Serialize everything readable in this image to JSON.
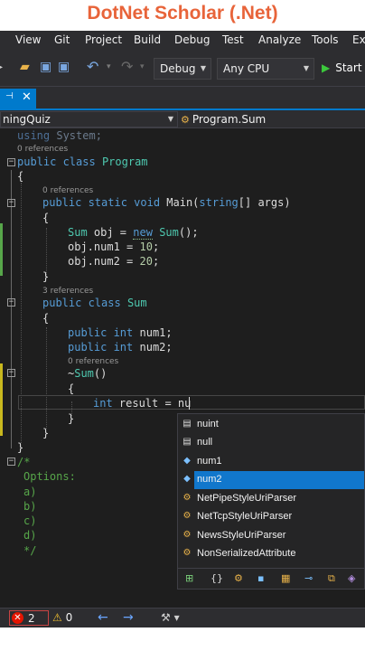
{
  "banner": {
    "title": "DotNet Scholar (.Net)",
    "color": "#e8643a"
  },
  "menu": [
    "View",
    "Git",
    "Project",
    "Build",
    "Debug",
    "Test",
    "Analyze",
    "Tools",
    "Ext"
  ],
  "toolbar": {
    "config": "Debug",
    "platform": "Any CPU",
    "start_label": "Start",
    "icons": [
      "new-project-icon",
      "open-folder-icon",
      "save-icon",
      "save-all-icon",
      "undo-icon",
      "redo-icon"
    ]
  },
  "tab": {
    "pin": "⊣",
    "close": "✕"
  },
  "nav": {
    "left": "ningQuiz",
    "right": "Program.Sum"
  },
  "code": {
    "l1": {
      "kw": "using",
      "rest": " System;"
    },
    "ref1": "0 references",
    "l2": {
      "kw1": "public",
      "kw2": " class",
      "name": " Program"
    },
    "l3": "{",
    "ref2": "0 references",
    "l4": {
      "kw1": "public",
      "kw2": " static",
      "kw3": " void",
      "rest1": " Main(",
      "kw4": "string",
      "rest2": "[] args)"
    },
    "l5": "{",
    "l6": {
      "type": "Sum",
      "a": " obj = ",
      "kw": "new",
      "b": " ",
      "type2": "Sum",
      "c": "();"
    },
    "l7": {
      "a": "obj.num1 = ",
      "n": "10",
      "b": ";"
    },
    "l8": {
      "a": "obj.num2 = ",
      "n": "20",
      "b": ";"
    },
    "l9": "}",
    "ref3": "3 references",
    "l10": {
      "kw1": "public",
      "kw2": " class",
      "name": " Sum"
    },
    "l11": "{",
    "l12": {
      "kw1": "public",
      "kw2": " int",
      "rest": " num1;"
    },
    "l13": {
      "kw1": "public",
      "kw2": " int",
      "rest": " num2;"
    },
    "ref4": "0 references",
    "l14": {
      "a": "~",
      "name": "Sum",
      "b": "()"
    },
    "l15": "{",
    "l16": {
      "kw": "int",
      "rest": " result = nu"
    },
    "l17": "}",
    "l18": "}",
    "l19": "}",
    "c1": "/*",
    "c2": "Options:",
    "c3": "a)",
    "c4": "b)",
    "c5": "c)",
    "c6": "d)",
    "c7": "*/"
  },
  "completion": {
    "items": [
      {
        "label": "nuint",
        "icon": "keyword-icon"
      },
      {
        "label": "null",
        "icon": "keyword-icon"
      },
      {
        "label": "num1",
        "icon": "field-icon"
      },
      {
        "label": "num2",
        "icon": "field-icon",
        "selected": true
      },
      {
        "label": "NetPipeStyleUriParser",
        "icon": "class-icon"
      },
      {
        "label": "NetTcpStyleUriParser",
        "icon": "class-icon"
      },
      {
        "label": "NewsStyleUriParser",
        "icon": "class-icon"
      },
      {
        "label": "NonSerializedAttribute",
        "icon": "class-icon"
      }
    ],
    "selection_color": "#1177cc"
  },
  "status": {
    "errors": "2",
    "warnings": "0"
  }
}
